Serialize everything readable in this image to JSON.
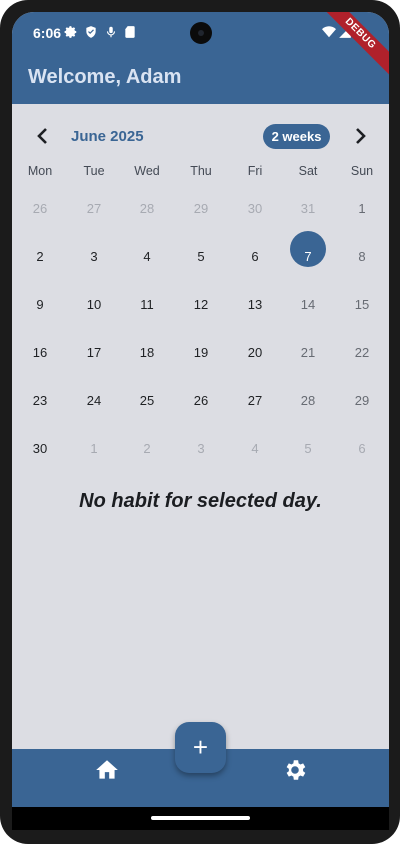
{
  "status_bar": {
    "time": "6:06",
    "icons_left": [
      "settings-icon",
      "shield-icon",
      "microphone-icon",
      "sd-card-icon"
    ],
    "icons_right": [
      "wifi-icon",
      "signal-icon",
      "battery-icon"
    ]
  },
  "debug_banner": "DEBUG",
  "header": {
    "title": "Welcome, Adam"
  },
  "calendar": {
    "month_title": "June 2025",
    "format_button": "2 weeks",
    "weekdays": [
      "Mon",
      "Tue",
      "Wed",
      "Thu",
      "Fri",
      "Sat",
      "Sun"
    ],
    "weeks": [
      [
        "26",
        "27",
        "28",
        "29",
        "30",
        "31",
        "1"
      ],
      [
        "2",
        "3",
        "4",
        "5",
        "6",
        "7",
        "8"
      ],
      [
        "9",
        "10",
        "11",
        "12",
        "13",
        "14",
        "15"
      ],
      [
        "16",
        "17",
        "18",
        "19",
        "20",
        "21",
        "22"
      ],
      [
        "23",
        "24",
        "25",
        "26",
        "27",
        "28",
        "29"
      ],
      [
        "30",
        "1",
        "2",
        "3",
        "4",
        "5",
        "6"
      ]
    ],
    "selected_day": "7"
  },
  "empty_message": "No habit for selected day.",
  "fab_label": "+",
  "bottom_nav": {
    "items": [
      "home-icon",
      "settings-icon"
    ]
  },
  "colors": {
    "primary": "#3a6594",
    "background": "#dcdde3",
    "header_text": "#d9e3f2"
  }
}
